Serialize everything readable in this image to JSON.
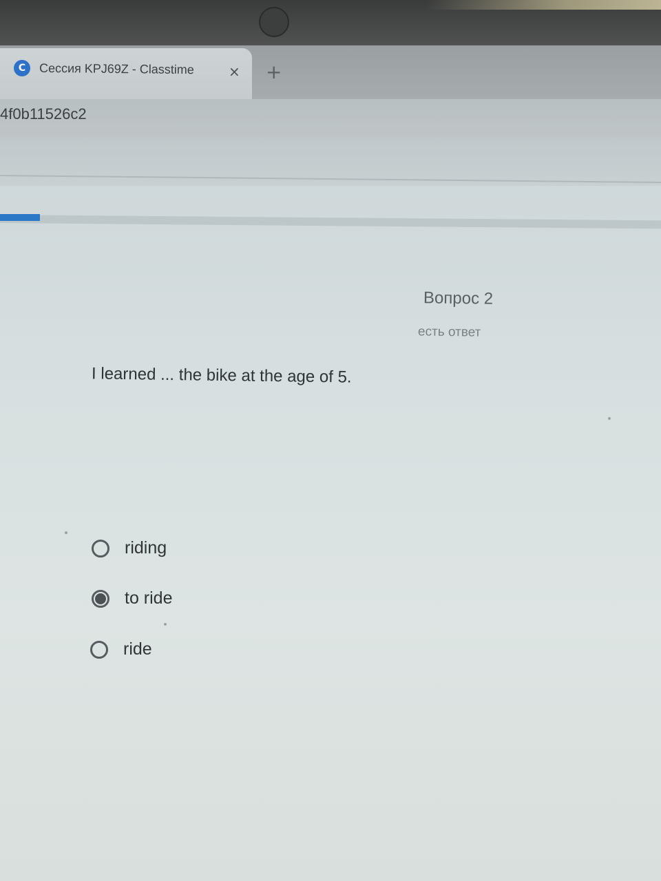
{
  "browser": {
    "tab": {
      "favicon_letter": "C",
      "title": "Сессия KPJ69Z - Classtime",
      "close_label": "×"
    },
    "new_tab_label": "+",
    "address_bar": {
      "url_fragment": "4f0b11526c2"
    }
  },
  "progress": {
    "fill_fraction": 0.06,
    "accent_color": "#2a78c6"
  },
  "question": {
    "number_label": "Вопрос 2",
    "status_label": "есть ответ",
    "text": "I learned ... the bike at the age of 5.",
    "options": [
      {
        "label": "riding",
        "selected": false
      },
      {
        "label": "to ride",
        "selected": true
      },
      {
        "label": "ride",
        "selected": false
      }
    ]
  }
}
